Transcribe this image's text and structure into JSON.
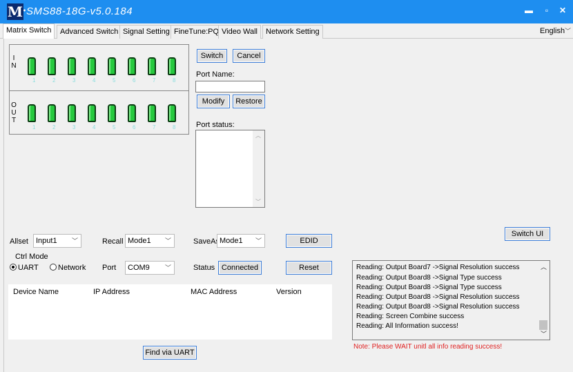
{
  "window": {
    "title": "SMS88-18G-v5.0.184",
    "logo": "M",
    "minimize_icon": "minimize-icon",
    "maximize_icon": "maximize-icon",
    "close_icon": "close-icon"
  },
  "tabs": [
    {
      "label": "Matrix Switch",
      "active": true
    },
    {
      "label": "Advanced Switch"
    },
    {
      "label": "Signal Setting"
    },
    {
      "label": "FineTune:PQ"
    },
    {
      "label": "Video Wall"
    },
    {
      "label": "Network Setting"
    }
  ],
  "language": {
    "value": "English"
  },
  "matrix": {
    "in_label": [
      "I",
      "N"
    ],
    "out_label": [
      "O",
      "U",
      "T"
    ],
    "port_numbers": [
      "1",
      "2",
      "3",
      "4",
      "5",
      "6",
      "7",
      "8"
    ],
    "port_color": "#27c93f"
  },
  "controls": {
    "switch": "Switch",
    "cancel": "Cancel",
    "port_name_label": "Port Name:",
    "port_name_value": "",
    "modify": "Modify",
    "restore": "Restore",
    "port_status_label": "Port status:",
    "switch_ui": "Switch UI"
  },
  "settings": {
    "allset_label": "Allset",
    "allset_value": "Input1",
    "recall_label": "Recall",
    "recall_value": "Mode1",
    "saveas_label": "SaveAs",
    "saveas_value": "Mode1",
    "edid": "EDID",
    "ctrl_mode_label": "Ctrl Mode",
    "uart_label": "UART",
    "network_label": "Network",
    "ctrl_mode_selected": "UART",
    "port_label": "Port",
    "port_value": "COM9",
    "status_label": "Status",
    "status_value": "Connected",
    "reset": "Reset"
  },
  "device_table": {
    "columns": [
      "Device Name",
      "IP Address",
      "MAC Address",
      "Version"
    ],
    "rows": []
  },
  "find_button": "Find via UART",
  "log": [
    "Reading: Output Board7 ->Signal Resolution success",
    "Reading: Output Board8 ->Signal Type success",
    "Reading: Output Board8 ->Signal Type success",
    "Reading: Output Board8 ->Signal Resolution success",
    "Reading: Output Board8 ->Signal Resolution success",
    "Reading: Screen Combine success",
    "Reading: All Information success!"
  ],
  "note": "Note: Please WAIT unitl all info reading success!"
}
